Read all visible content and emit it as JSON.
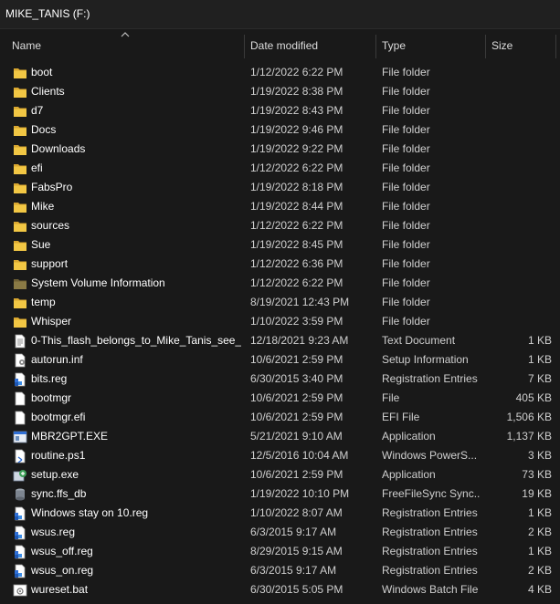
{
  "window": {
    "title": "MIKE_TANIS (F:)"
  },
  "columns": {
    "name": "Name",
    "date": "Date modified",
    "type": "Type",
    "size": "Size"
  },
  "colors": {
    "folder": "#f2c744",
    "folder_dim": "#8a7a45",
    "background": "#191919"
  },
  "rows": [
    {
      "name": "boot",
      "date": "1/12/2022 6:22 PM",
      "type": "File folder",
      "size": "",
      "icon": "folder-icon"
    },
    {
      "name": "Clients",
      "date": "1/19/2022 8:38 PM",
      "type": "File folder",
      "size": "",
      "icon": "folder-icon"
    },
    {
      "name": "d7",
      "date": "1/19/2022 8:43 PM",
      "type": "File folder",
      "size": "",
      "icon": "folder-icon"
    },
    {
      "name": "Docs",
      "date": "1/19/2022 9:46 PM",
      "type": "File folder",
      "size": "",
      "icon": "folder-icon"
    },
    {
      "name": "Downloads",
      "date": "1/19/2022 9:22 PM",
      "type": "File folder",
      "size": "",
      "icon": "folder-icon"
    },
    {
      "name": "efi",
      "date": "1/12/2022 6:22 PM",
      "type": "File folder",
      "size": "",
      "icon": "folder-icon"
    },
    {
      "name": "FabsPro",
      "date": "1/19/2022 8:18 PM",
      "type": "File folder",
      "size": "",
      "icon": "folder-icon"
    },
    {
      "name": "Mike",
      "date": "1/19/2022 8:44 PM",
      "type": "File folder",
      "size": "",
      "icon": "folder-icon"
    },
    {
      "name": "sources",
      "date": "1/12/2022 6:22 PM",
      "type": "File folder",
      "size": "",
      "icon": "folder-icon"
    },
    {
      "name": "Sue",
      "date": "1/19/2022 8:45 PM",
      "type": "File folder",
      "size": "",
      "icon": "folder-icon"
    },
    {
      "name": "support",
      "date": "1/12/2022 6:36 PM",
      "type": "File folder",
      "size": "",
      "icon": "folder-icon"
    },
    {
      "name": "System Volume Information",
      "date": "1/12/2022 6:22 PM",
      "type": "File folder",
      "size": "",
      "icon": "system-folder-icon"
    },
    {
      "name": "temp",
      "date": "8/19/2021 12:43 PM",
      "type": "File folder",
      "size": "",
      "icon": "folder-icon"
    },
    {
      "name": "Whisper",
      "date": "1/10/2022 3:59 PM",
      "type": "File folder",
      "size": "",
      "icon": "folder-icon"
    },
    {
      "name": "0-This_flash_belongs_to_Mike_Tanis_see_...",
      "date": "12/18/2021 9:23 AM",
      "type": "Text Document",
      "size": "1 KB",
      "icon": "text-document-icon"
    },
    {
      "name": "autorun.inf",
      "date": "10/6/2021 2:59 PM",
      "type": "Setup Information",
      "size": "1 KB",
      "icon": "setup-information-icon"
    },
    {
      "name": "bits.reg",
      "date": "6/30/2015 3:40 PM",
      "type": "Registration Entries",
      "size": "7 KB",
      "icon": "registry-icon"
    },
    {
      "name": "bootmgr",
      "date": "10/6/2021 2:59 PM",
      "type": "File",
      "size": "405 KB",
      "icon": "file-icon"
    },
    {
      "name": "bootmgr.efi",
      "date": "10/6/2021 2:59 PM",
      "type": "EFI File",
      "size": "1,506 KB",
      "icon": "file-icon"
    },
    {
      "name": "MBR2GPT.EXE",
      "date": "5/21/2021 9:10 AM",
      "type": "Application",
      "size": "1,137 KB",
      "icon": "application-icon"
    },
    {
      "name": "routine.ps1",
      "date": "12/5/2016 10:04 AM",
      "type": "Windows PowerS...",
      "size": "3 KB",
      "icon": "powershell-script-icon"
    },
    {
      "name": "setup.exe",
      "date": "10/6/2021 2:59 PM",
      "type": "Application",
      "size": "73 KB",
      "icon": "setup-app-icon"
    },
    {
      "name": "sync.ffs_db",
      "date": "1/19/2022 10:10 PM",
      "type": "FreeFileSync Sync...",
      "size": "19 KB",
      "icon": "freefilesync-db-icon"
    },
    {
      "name": "Windows stay on 10.reg",
      "date": "1/10/2022 8:07 AM",
      "type": "Registration Entries",
      "size": "1 KB",
      "icon": "registry-icon"
    },
    {
      "name": "wsus.reg",
      "date": "6/3/2015 9:17 AM",
      "type": "Registration Entries",
      "size": "2 KB",
      "icon": "registry-icon"
    },
    {
      "name": "wsus_off.reg",
      "date": "8/29/2015 9:15 AM",
      "type": "Registration Entries",
      "size": "1 KB",
      "icon": "registry-icon"
    },
    {
      "name": "wsus_on.reg",
      "date": "6/3/2015 9:17 AM",
      "type": "Registration Entries",
      "size": "2 KB",
      "icon": "registry-icon"
    },
    {
      "name": "wureset.bat",
      "date": "6/30/2015 5:05 PM",
      "type": "Windows Batch File",
      "size": "4 KB",
      "icon": "batch-file-icon"
    }
  ]
}
